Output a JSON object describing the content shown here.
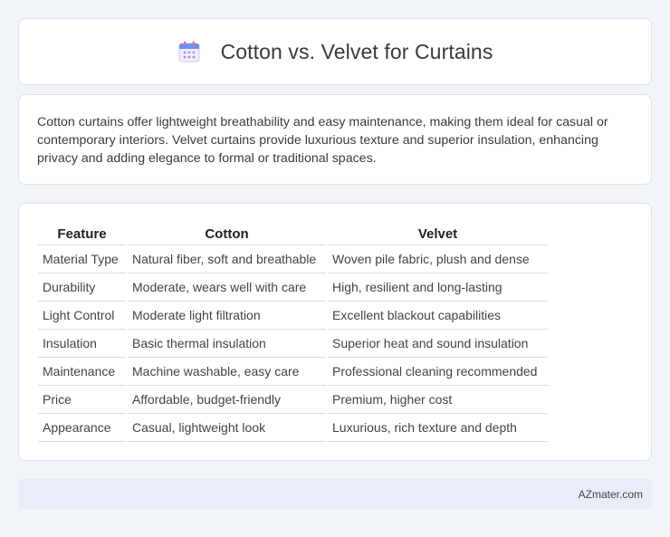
{
  "header": {
    "title": "Cotton vs. Velvet for Curtains",
    "icon": "calendar-icon"
  },
  "intro": {
    "text": "Cotton curtains offer lightweight breathability and easy maintenance, making them ideal for casual or contemporary interiors. Velvet curtains provide luxurious texture and superior insulation, enhancing privacy and adding elegance to formal or traditional spaces."
  },
  "table": {
    "headers": [
      "Feature",
      "Cotton",
      "Velvet"
    ],
    "rows": [
      [
        "Material Type",
        "Natural fiber, soft and breathable",
        "Woven pile fabric, plush and dense"
      ],
      [
        "Durability",
        "Moderate, wears well with care",
        "High, resilient and long-lasting"
      ],
      [
        "Light Control",
        "Moderate light filtration",
        "Excellent blackout capabilities"
      ],
      [
        "Insulation",
        "Basic thermal insulation",
        "Superior heat and sound insulation"
      ],
      [
        "Maintenance",
        "Machine washable, easy care",
        "Professional cleaning recommended"
      ],
      [
        "Price",
        "Affordable, budget-friendly",
        "Premium, higher cost"
      ],
      [
        "Appearance",
        "Casual, lightweight look",
        "Luxurious, rich texture and depth"
      ]
    ]
  },
  "footer": {
    "brand": "AZmater.com"
  },
  "colors": {
    "background": "#f1f4f9",
    "card": "#ffffff",
    "footer": "#e8edf7"
  }
}
